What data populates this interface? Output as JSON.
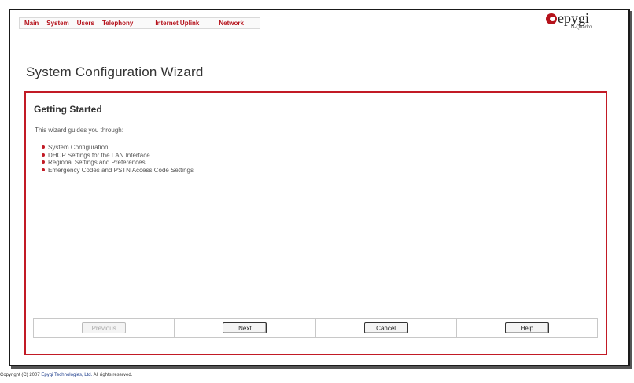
{
  "nav": {
    "items": [
      "Main",
      "System",
      "Users",
      "Telephony",
      "Internet Uplink",
      "Network"
    ]
  },
  "logo": {
    "brand": "epygi",
    "product": "D-Quadro"
  },
  "page_title": "System Configuration Wizard",
  "panel": {
    "title": "Getting Started",
    "intro": "This wizard guides you through:",
    "steps": [
      "System Configuration",
      "DHCP Settings for the LAN Interface",
      "Regional Settings and Preferences",
      "Emergency Codes and PSTN Access Code Settings"
    ]
  },
  "buttons": {
    "previous": "Previous",
    "next": "Next",
    "cancel": "Cancel",
    "help": "Help"
  },
  "footer": {
    "prefix": "Copyright (C) 2007",
    "company": "Epygi Technologies, Ltd.",
    "suffix": "All rights reserved."
  },
  "colors": {
    "accent": "#c21a25",
    "nav_text": "#b5121b"
  }
}
